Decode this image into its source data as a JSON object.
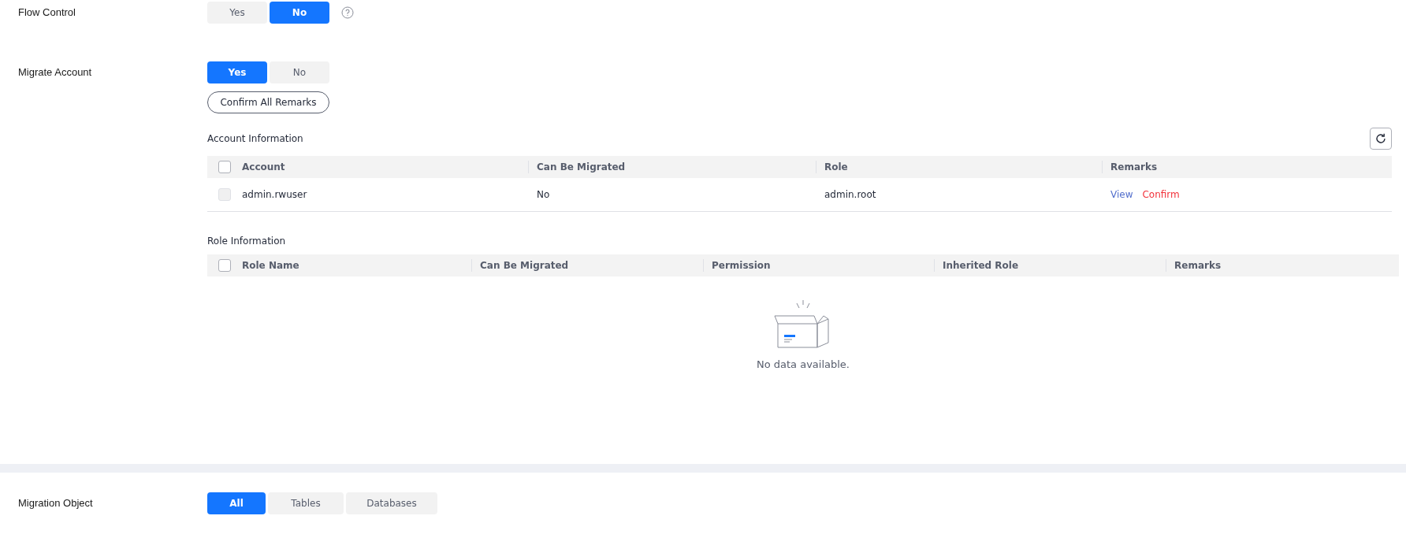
{
  "flow_control": {
    "label": "Flow Control",
    "options": [
      {
        "label": "Yes",
        "selected": false
      },
      {
        "label": "No",
        "selected": true
      }
    ]
  },
  "migrate_account": {
    "label": "Migrate Account",
    "options": [
      {
        "label": "Yes",
        "selected": true
      },
      {
        "label": "No",
        "selected": false
      }
    ],
    "confirm_button": "Confirm All Remarks"
  },
  "account_table": {
    "title": "Account Information",
    "header_checked": false,
    "columns": [
      "Account",
      "Can Be Migrated",
      "Role",
      "Remarks"
    ],
    "rows": [
      {
        "checked": false,
        "disabled": true,
        "account": "admin.rwuser",
        "can_be_migrated": "No",
        "role": "admin.root",
        "actions": [
          {
            "label": "View",
            "kind": "link"
          },
          {
            "label": "Confirm",
            "kind": "danger"
          }
        ]
      }
    ]
  },
  "role_table": {
    "title": "Role Information",
    "header_checked": false,
    "columns": [
      "Role Name",
      "Can Be Migrated",
      "Permission",
      "Inherited Role",
      "Remarks"
    ],
    "empty_text": "No data available."
  },
  "migration_object": {
    "label": "Migration Object",
    "options": [
      {
        "label": "All",
        "selected": true
      },
      {
        "label": "Tables",
        "selected": false
      },
      {
        "label": "Databases",
        "selected": false
      }
    ]
  }
}
